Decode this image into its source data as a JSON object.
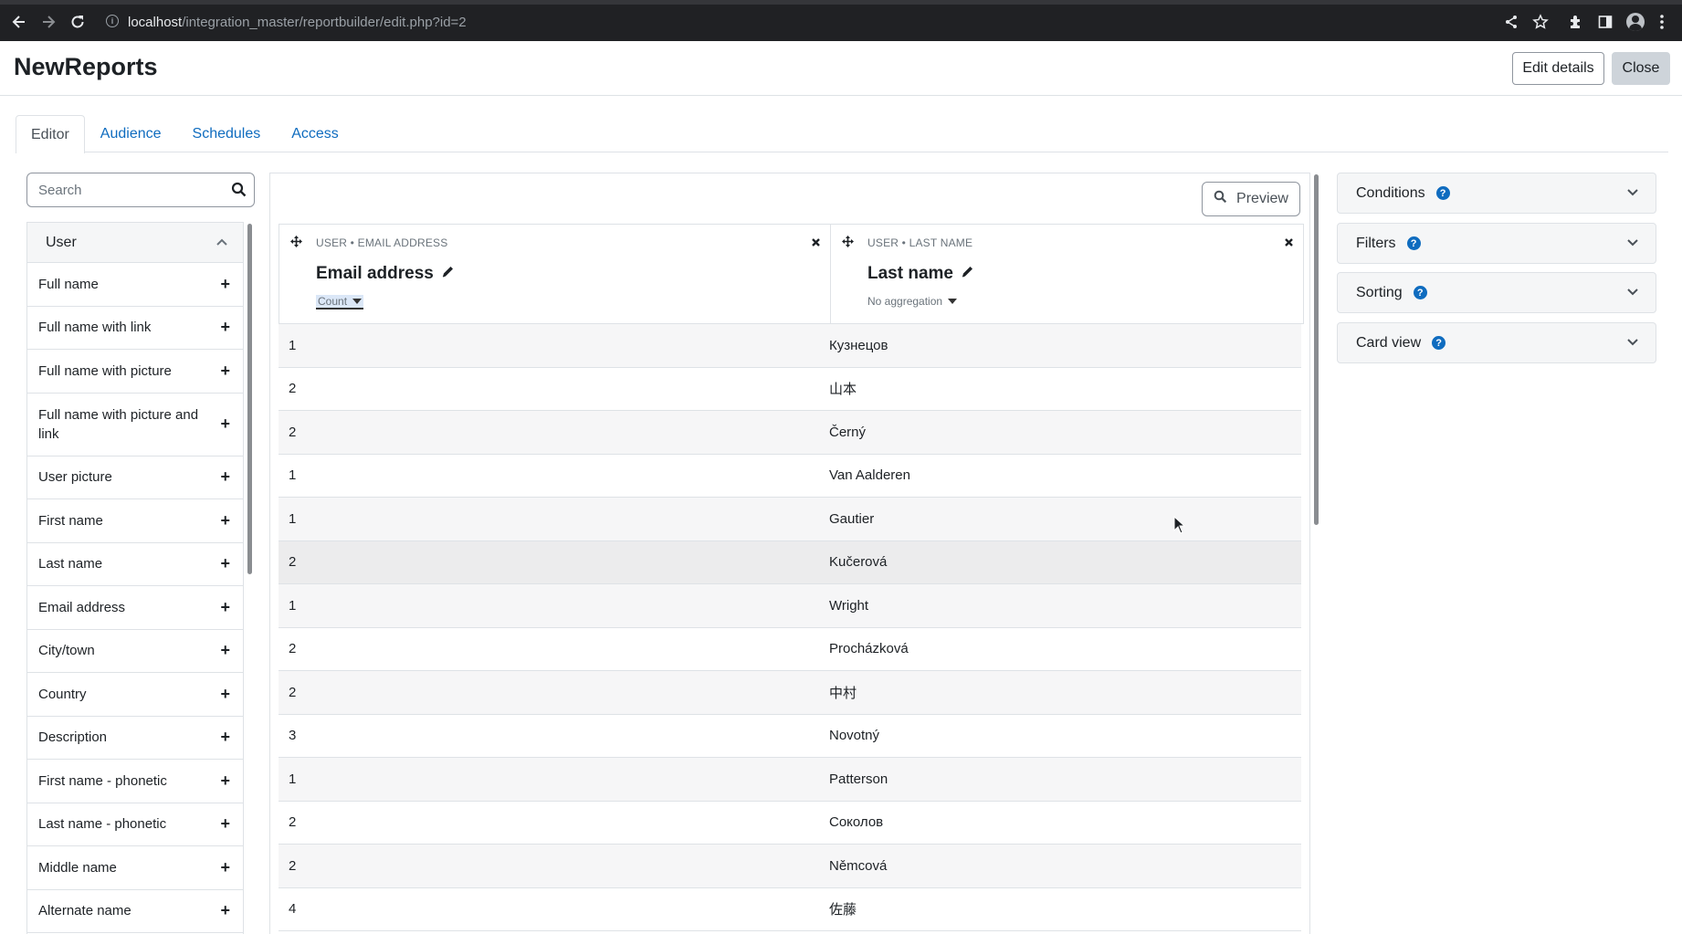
{
  "browser": {
    "url_host": "localhost",
    "url_path": "/integration_master/reportbuilder/edit.php?id=2"
  },
  "header": {
    "title": "NewReports",
    "edit_details_label": "Edit details",
    "close_label": "Close"
  },
  "tabs": [
    {
      "label": "Editor",
      "active": true
    },
    {
      "label": "Audience",
      "active": false
    },
    {
      "label": "Schedules",
      "active": false
    },
    {
      "label": "Access",
      "active": false
    }
  ],
  "sidebar": {
    "search_placeholder": "Search",
    "group_label": "User",
    "items": [
      {
        "label": "Full name"
      },
      {
        "label": "Full name with link"
      },
      {
        "label": "Full name with picture"
      },
      {
        "label": "Full name with picture and link"
      },
      {
        "label": "User picture"
      },
      {
        "label": "First name"
      },
      {
        "label": "Last name"
      },
      {
        "label": "Email address"
      },
      {
        "label": "City/town"
      },
      {
        "label": "Country"
      },
      {
        "label": "Description"
      },
      {
        "label": "First name - phonetic"
      },
      {
        "label": "Last name - phonetic"
      },
      {
        "label": "Middle name"
      },
      {
        "label": "Alternate name"
      }
    ]
  },
  "editor": {
    "preview_label": "Preview",
    "columns": [
      {
        "source": "USER • EMAIL ADDRESS",
        "name": "Email address",
        "aggregation": "Count"
      },
      {
        "source": "USER • LAST NAME",
        "name": "Last name",
        "aggregation": "No aggregation"
      }
    ],
    "rows": [
      {
        "count": "1",
        "last_name": "Кузнецов"
      },
      {
        "count": "2",
        "last_name": "山本"
      },
      {
        "count": "2",
        "last_name": "Černý"
      },
      {
        "count": "1",
        "last_name": "Van Aalderen"
      },
      {
        "count": "1",
        "last_name": "Gautier"
      },
      {
        "count": "2",
        "last_name": "Kučerová"
      },
      {
        "count": "1",
        "last_name": "Wright"
      },
      {
        "count": "2",
        "last_name": "Procházková"
      },
      {
        "count": "2",
        "last_name": "中村"
      },
      {
        "count": "3",
        "last_name": "Novotný"
      },
      {
        "count": "1",
        "last_name": "Patterson"
      },
      {
        "count": "2",
        "last_name": "Соколов"
      },
      {
        "count": "2",
        "last_name": "Němcová"
      },
      {
        "count": "4",
        "last_name": "佐藤"
      }
    ]
  },
  "settings_panels": [
    {
      "label": "Conditions"
    },
    {
      "label": "Filters"
    },
    {
      "label": "Sorting"
    },
    {
      "label": "Card view"
    }
  ],
  "colors": {
    "link": "#0f6cbf",
    "help_icon": "#0f6cbf",
    "chrome_bg": "#202124"
  }
}
